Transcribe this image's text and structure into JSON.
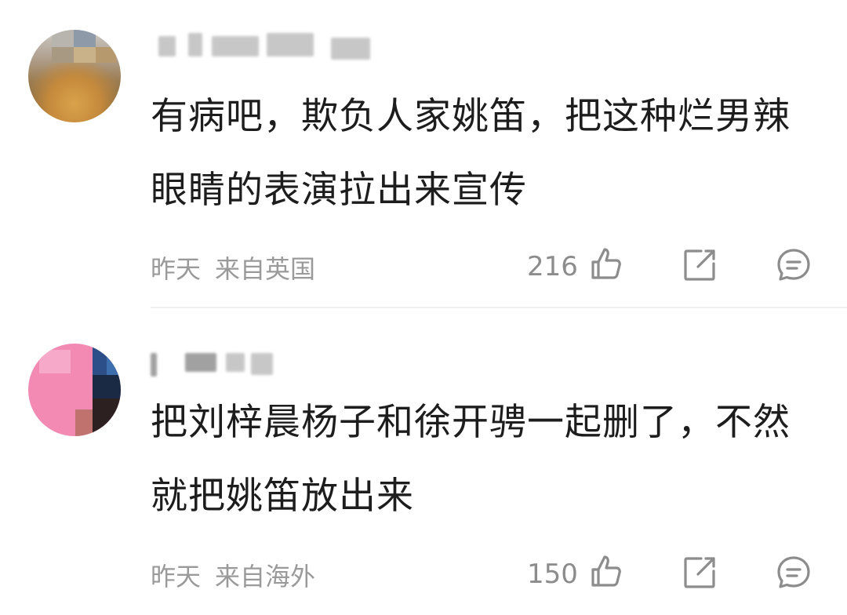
{
  "comments": [
    {
      "text": "有病吧，欺负人家姚笛，把这种烂男辣眼睛的表演拉出来宣传",
      "time": "昨天",
      "location": "来自英国",
      "likes": "216"
    },
    {
      "text": "把刘梓晨杨子和徐开骋一起删了，不然就把姚笛放出来",
      "time": "昨天",
      "location": "来自海外",
      "likes": "150"
    }
  ],
  "icons": {
    "like": "thumbs-up-icon",
    "share": "share-icon",
    "reply": "comment-icon"
  },
  "colors": {
    "text": "#1d1d1d",
    "meta": "#9a9a9a",
    "icon": "#8c8c8c"
  }
}
